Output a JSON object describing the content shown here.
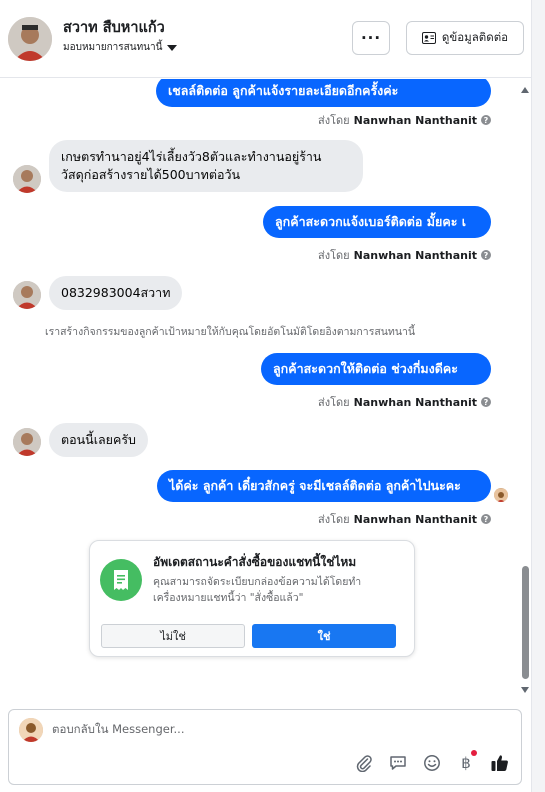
{
  "header": {
    "name": "สวาท สืบหาแก้ว",
    "assign_label": "มอบหมายการสนทนานี้",
    "more_label": "···",
    "contact_button": "ดูข้อมูลติดต่อ"
  },
  "messages": {
    "m1": "เชลล์ติดต่อ ลูกค้าแจ้งรายละเอียดอีกครั้งค่ะ",
    "m1_sender_prefix": "ส่งโดย",
    "m1_sender_name": "Nanwhan Nanthanit",
    "m2_line1": "เกษตรทำนาอยู่4ไร่เลี้ยงวัว8ตัวและทำงานอยู่ร้าน",
    "m2_line2": "วัสดุก่อสร้างรายได้500บาทต่อวัน",
    "m3": "ลูกค้าสะดวกแจ้งเบอร์ติดต่อ มั้ยคะ เ",
    "m3_sender_prefix": "ส่งโดย",
    "m3_sender_name": "Nanwhan Nanthanit",
    "m4": "0832983004สวาท",
    "system_note": "เราสร้างกิจกรรมของลูกค้าเป้าหมายให้กับคุณโดยอัตโนมัติโดยอิงตามการสนทนานี้",
    "m5": "ลูกค้าสะดวกให้ติดต่อ ช่วงกี่มงดีคะ",
    "m5_sender_prefix": "ส่งโดย",
    "m5_sender_name": "Nanwhan Nanthanit",
    "m6": "ตอนนี้เลยครับ",
    "m7": "ได้ค่ะ ลูกค้า เดี๋ยวสักครู่ จะมีเชลล์ติดต่อ ลูกค้าไปนะคะ",
    "m7_sender_prefix": "ส่งโดย",
    "m7_sender_name": "Nanwhan Nanthanit"
  },
  "order_card": {
    "title": "อัพเดตสถานะคำสั่งซื้อของแชทนี้ใช่ไหม",
    "body": "คุณสามารถจัดระเบียบกล่องข้อความได้โดยทำเครื่องหมายแชทนี้ว่า \"สั่งซื้อแล้ว\"",
    "no_label": "ไม่ใช่",
    "yes_label": "ใช่"
  },
  "composer": {
    "placeholder": "ตอบกลับใน Messenger..."
  },
  "colors": {
    "outgoing": "#0866ff",
    "incoming": "#e9ebee",
    "primary_button": "#1877f2",
    "card_icon": "#45bd62"
  }
}
